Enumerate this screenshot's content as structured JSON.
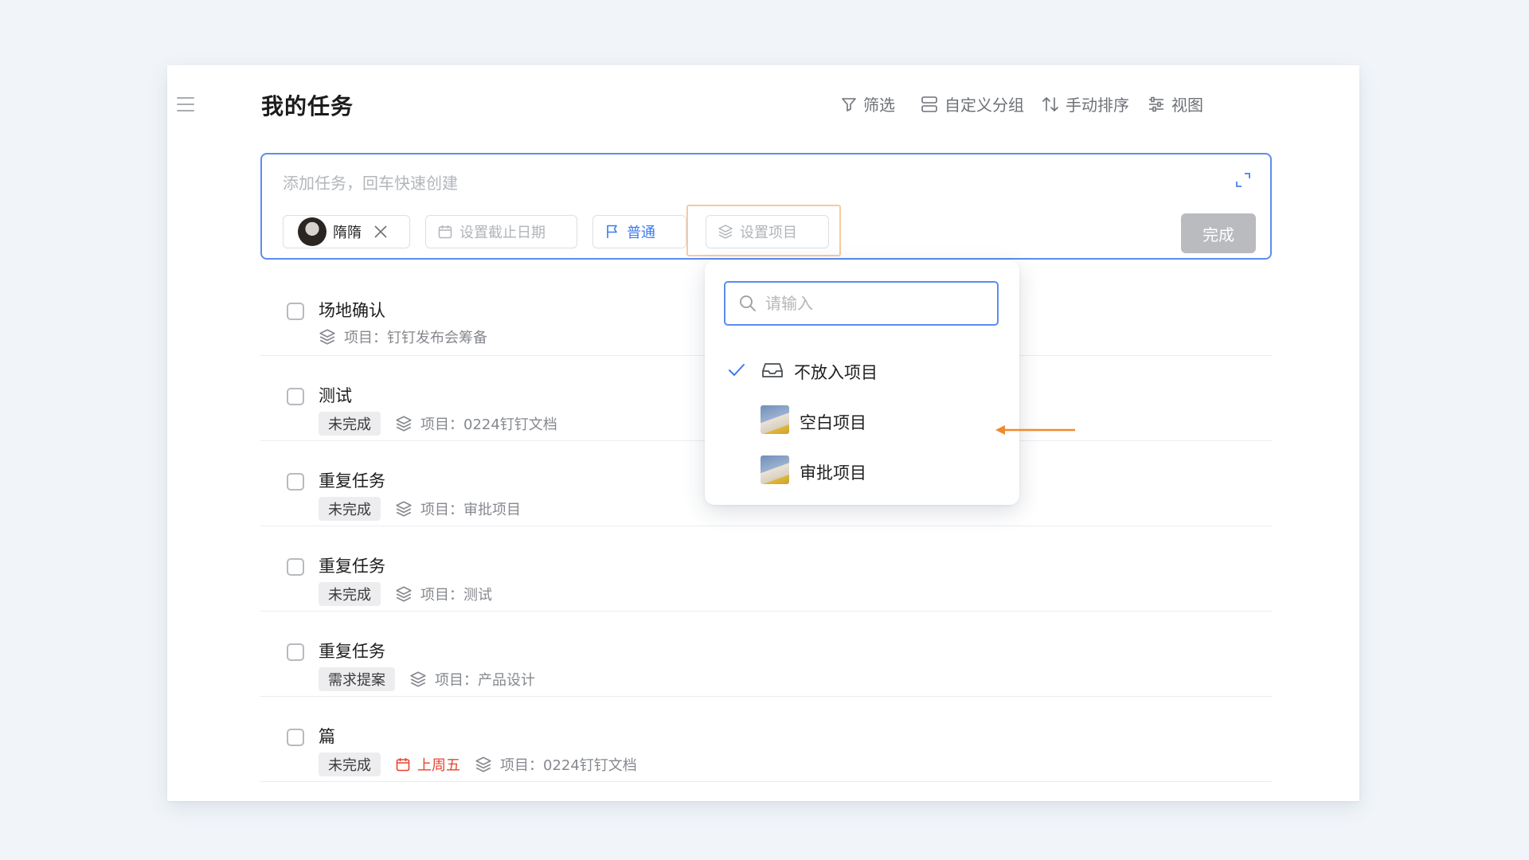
{
  "header": {
    "title": "我的任务",
    "filter_label": "筛选",
    "group_label": "自定义分组",
    "sort_label": "手动排序",
    "view_label": "视图"
  },
  "composer": {
    "placeholder": "添加任务，回车快速创建",
    "assignee": "隋隋",
    "deadline_label": "设置截止日期",
    "priority_label": "普通",
    "project_label": "设置项目",
    "submit_label": "完成"
  },
  "tasks": [
    {
      "title": "场地确认",
      "status": "",
      "date": "",
      "project": "项目：钉钉发布会筹备"
    },
    {
      "title": "测试",
      "status": "未完成",
      "date": "",
      "project": "项目：0224钉钉文档"
    },
    {
      "title": "重复任务",
      "status": "未完成",
      "date": "",
      "project": "项目：审批项目"
    },
    {
      "title": "重复任务",
      "status": "未完成",
      "date": "",
      "project": "项目：测试"
    },
    {
      "title": "重复任务",
      "status": "需求提案",
      "date": "",
      "project": "项目：产品设计"
    },
    {
      "title": "篇",
      "status": "未完成",
      "date": "上周五",
      "project": "项目：0224钉钉文档"
    }
  ],
  "project_dropdown": {
    "search_placeholder": "请输入",
    "options": [
      {
        "label": "不放入项目",
        "selected": true
      },
      {
        "label": "空白项目",
        "selected": false
      },
      {
        "label": "审批项目",
        "selected": false
      }
    ]
  },
  "colors": {
    "accent": "#5b8def",
    "priority_blue": "#3a7bf0",
    "overdue_red": "#e8442e",
    "highlight_orange": "#f8c9a0",
    "annotation_arrow": "#ef8a2f"
  }
}
